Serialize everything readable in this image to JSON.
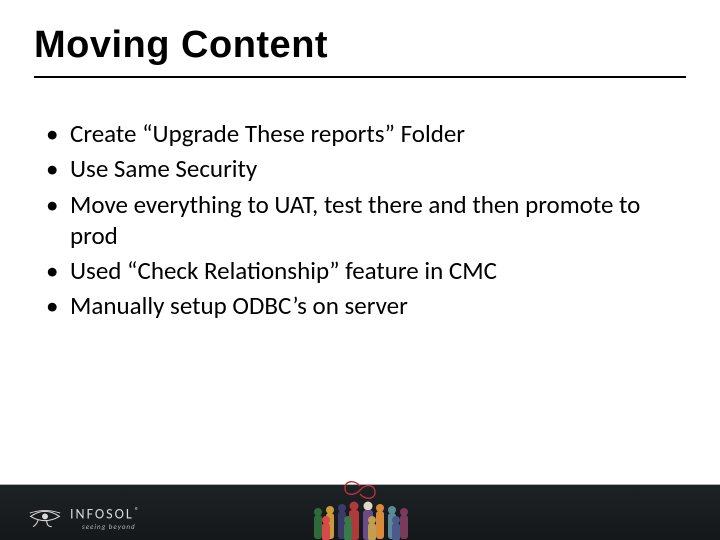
{
  "title": "Moving Content",
  "bullets": [
    "Create “Upgrade These reports” Folder",
    "Use Same Security",
    "Move everything to UAT, test there and then promote to prod",
    "Used “Check Relationship” feature in CMC",
    "Manually setup ODBC’s on server"
  ],
  "footer": {
    "logo_text": "INFOSOL",
    "registered": "®",
    "tagline": "seeing beyond"
  }
}
